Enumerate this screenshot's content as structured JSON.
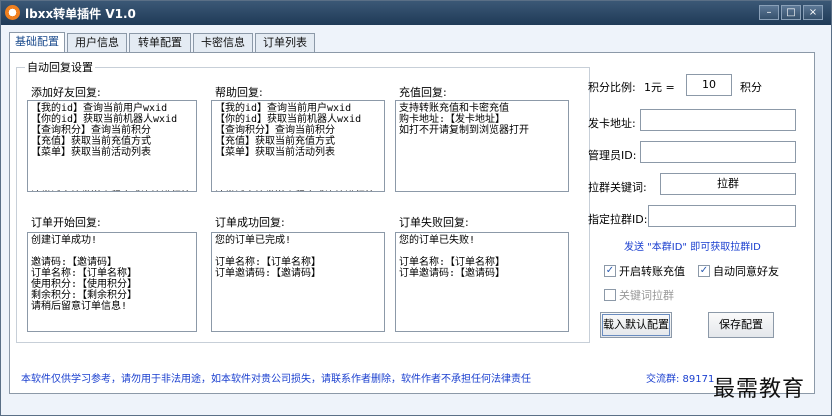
{
  "window": {
    "title": "lbxx转单插件 V1.0",
    "minimize": "–",
    "maximize": "□",
    "close": "×"
  },
  "tabs": [
    "基础配置",
    "用户信息",
    "转单配置",
    "卡密信息",
    "订单列表"
  ],
  "auto_reply": {
    "group_title": "自动回复设置",
    "add_friend": {
      "label": "添加好友回复:",
      "text": "【我的id】查询当前用户wxid\n【你的id】获取当前机器人wxid\n【查询积分】查询当前积分\n【充值】获取当前充值方式\n【菜单】获取当前活动列表\n\n\n\n请尝试直接发送小程序或连接进行快速下单"
    },
    "help": {
      "label": "帮助回复:",
      "text": "【我的id】查询当前用户wxid\n【你的id】获取当前机器人wxid\n【查询积分】查询当前积分\n【充值】获取当前充值方式\n【菜单】获取当前活动列表\n\n\n\n请尝试直接发送小程序或连接进行快速下单"
    },
    "recharge": {
      "label": "充值回复:",
      "text": "支持转账充值和卡密充值\n购卡地址:【发卡地址】\n如打不开请复制到浏览器打开"
    },
    "order_start": {
      "label": "订单开始回复:",
      "text": "创建订单成功!\n\n邀请码:【邀请码】\n订单名称:【订单名称】\n使用积分:【使用积分】\n剩余积分:【剩余积分】\n请稍后留意订单信息!"
    },
    "order_success": {
      "label": "订单成功回复:",
      "text": "您的订单已完成!\n\n订单名称:【订单名称】\n订单邀请码:【邀请码】"
    },
    "order_fail": {
      "label": "订单失败回复:",
      "text": "您的订单已失败!\n\n订单名称:【订单名称】\n订单邀请码:【邀请码】"
    }
  },
  "settings": {
    "ratio_label": "积分比例:",
    "ratio_prefix": "1元 =",
    "ratio_value": "10",
    "ratio_unit": "积分",
    "card_url_label": "发卡地址:",
    "card_url_value": "",
    "admin_id_label": "管理员ID:",
    "admin_id_value": "",
    "group_keyword_label": "拉群关键词:",
    "group_keyword_value": "拉群",
    "target_group_label": "指定拉群ID:",
    "target_group_value": "",
    "group_id_tip": "发送 \"本群ID\" 即可获取拉群ID"
  },
  "checkboxes": {
    "enable_transfer": {
      "label": "开启转账充值",
      "checked": true
    },
    "auto_accept": {
      "label": "自动同意好友",
      "checked": true
    },
    "keyword_group": {
      "label": "关键词拉群",
      "checked": false
    }
  },
  "buttons": {
    "load_default": "载入默认配置",
    "save": "保存配置"
  },
  "footer": {
    "disclaimer": "本软件仅供学习参考，请勿用于非法用途，如本软件对贵公司损失，请联系作者删除，软件作者不承担任何法律责任",
    "qq_group": "交流群: 89171",
    "watermark": "最需教育"
  },
  "colors": {
    "titlebar": "#2a4766",
    "link_blue": "#1a3fcf",
    "window_bg": "#eef3fa"
  }
}
